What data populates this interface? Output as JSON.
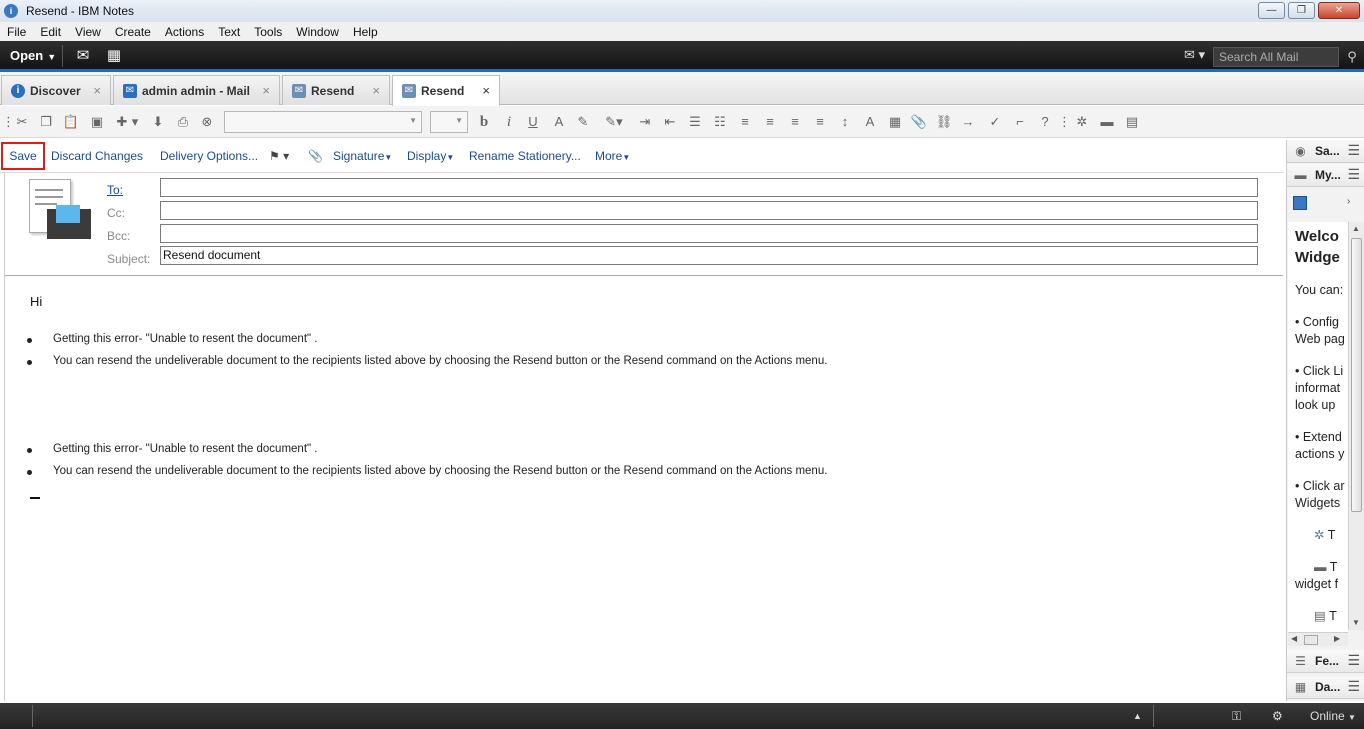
{
  "window": {
    "title": "Resend  - IBM Notes",
    "app_icon_glyph": "i",
    "min_glyph": "—",
    "max_glyph": "❐",
    "close_glyph": "✕"
  },
  "menu": [
    "File",
    "Edit",
    "View",
    "Create",
    "Actions",
    "Text",
    "Tools",
    "Window",
    "Help"
  ],
  "darkbar": {
    "open_label": "Open",
    "search_placeholder": "Search All Mail",
    "icons": [
      "mail-icon",
      "calendar-icon",
      "search-icon"
    ]
  },
  "tabs": [
    {
      "label": "Discover",
      "icon": "info-icon",
      "color": "#2a6ec0"
    },
    {
      "label": "admin admin - Mail",
      "icon": "mail-icon",
      "color": "#2a6ec0"
    },
    {
      "label": "Resend",
      "icon": "memo-icon",
      "color": "#6b8fb5"
    },
    {
      "label": "Resend",
      "icon": "memo-icon",
      "color": "#6b8fb5",
      "active": true
    }
  ],
  "tab_close_glyph": "×",
  "actions": {
    "save": "Save",
    "discard": "Discard Changes",
    "delivery": "Delivery Options...",
    "signature": "Signature",
    "display": "Display",
    "rename": "Rename Stationery...",
    "more": "More"
  },
  "fields": {
    "to_label": "To:",
    "cc_label": "Cc:",
    "bcc_label": "Bcc:",
    "subject_label": "Subject:",
    "to_value": "",
    "cc_value": "",
    "bcc_value": "",
    "subject_value": "Resend document"
  },
  "body": {
    "greeting": "Hi",
    "bullets": [
      "Getting this error- \"Unable to resent the document\" .",
      "You can resend the undeliverable document to the recipients listed above by choosing the Resend button or the Resend command on the Actions menu.",
      "Getting this error- \"Unable to resent the document\" .",
      "You can resend the undeliverable document to the recipients listed above by choosing the Resend button or the Resend command on the Actions menu."
    ]
  },
  "sidebar": {
    "panels": [
      "Sa...",
      "My...",
      "Fe...",
      "Da..."
    ],
    "welcome_title_1": "Welco",
    "welcome_title_2": "Widge",
    "lines": [
      "You can:",
      "• Config",
      "Web pag",
      "• Click Li",
      "informat",
      "look up",
      "• Extend",
      "actions y",
      "• Click ar",
      "Widgets",
      "T",
      "T",
      "widget f",
      "T"
    ]
  },
  "status": {
    "online": "Online"
  },
  "colors": {
    "accent": "#1c6fb8",
    "save_highlight": "#e21a1a",
    "link": "#1a4d8f"
  }
}
